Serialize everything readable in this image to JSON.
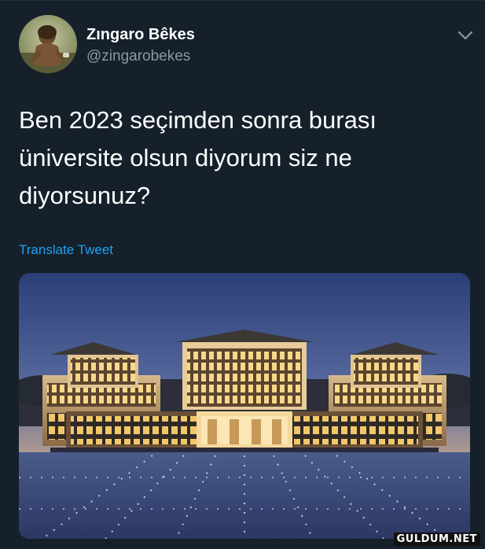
{
  "user": {
    "display_name": "Zıngaro Bêkes",
    "handle": "@zingarobekes"
  },
  "tweet": {
    "text": "Ben 2023 seçimden sonra burası üniversite olsun diyorum siz ne diyorsunuz?",
    "translate_label": "Translate Tweet"
  },
  "icons": {
    "menu": "chevron-down-icon"
  },
  "colors": {
    "background": "#15202b",
    "primary_text": "#ffffff",
    "secondary_text": "#8899a6",
    "link": "#1da1f2"
  },
  "watermark": {
    "text": "GULDUM.NET"
  }
}
